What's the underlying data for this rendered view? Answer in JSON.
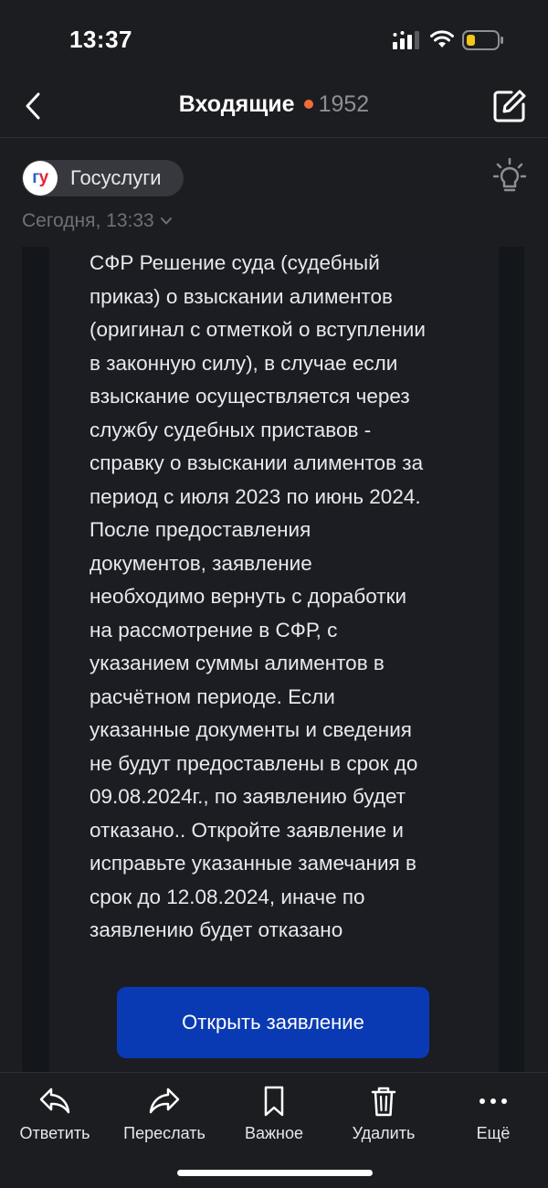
{
  "status_bar": {
    "time": "13:37",
    "battery_color": "#f5c518"
  },
  "nav": {
    "title": "Входящие",
    "unread_count": "1952",
    "dot_color": "#f26b3a"
  },
  "sender": {
    "logo_text_g": "г",
    "logo_text_u": "у",
    "name": "Госуслуги",
    "date": "Сегодня, 13:33"
  },
  "message": {
    "lines": [
      "СФР Решение суда (судебный",
      "приказ) о взыскании алиментов",
      "(оригинал с отметкой о вступлении",
      "в законную силу), в случае если",
      "взыскание осуществляется через",
      "службу судебных приставов -",
      "справку о взыскании алиментов за",
      "период с июля 2023 по июнь 2024.",
      "После предоставления",
      "документов, заявление",
      "необходимо вернуть с доработки",
      "на рассмотрение в СФР, с",
      "указанием суммы алиментов в",
      "расчётном периоде. Если",
      "указанные документы и сведения",
      "не будут предоставлены в срок до",
      "09.08.2024г., по заявлению будет",
      "отказано.. Откройте заявление и",
      "исправьте указанные замечания в",
      "срок до 12.08.2024, иначе по",
      "заявлению будет отказано"
    ],
    "button_label": "Открыть заявление",
    "button_color": "#0a3ab3"
  },
  "toolbar": {
    "reply": "Ответить",
    "forward": "Переслать",
    "important": "Важное",
    "delete": "Удалить",
    "more": "Ещё"
  }
}
